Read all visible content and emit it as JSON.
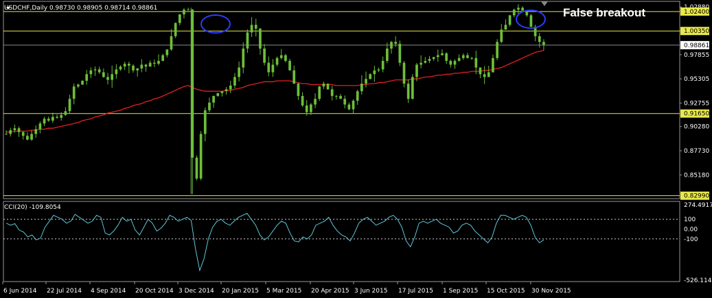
{
  "window": {
    "symbol_line": "USDCHF,Daily  0.98730 0.98905 0.98714 0.98861",
    "indicator_line": "CCI(20) -109.8054",
    "annotation": "False breakout"
  },
  "colors": {
    "background": "#000000",
    "candles": "#6cbf3a",
    "moving_average": "#e52020",
    "level_lines": "#e8e84a",
    "cci_line": "#5fc8d8",
    "grid_text": "#ffffff",
    "highlight_ellipse": "#2a3dff"
  },
  "chart_data": [
    {
      "type": "candlestick",
      "title": "USDCHF,Daily",
      "ohlc_latest": {
        "open": 0.9873,
        "high": 0.98905,
        "low": 0.98714,
        "close": 0.98861
      },
      "ylim": [
        0.8275,
        1.034
      ],
      "y_ticks": [
        "1.02880",
        "1.00350",
        "0.97855",
        "0.95305",
        "0.92755",
        "0.90280",
        "0.87730",
        "0.85180"
      ],
      "level_lines": [
        {
          "value": 1.024,
          "label": "1.02400"
        },
        {
          "value": 1.0035,
          "label": "1.00350"
        },
        {
          "value": 0.9165,
          "label": "0.91650"
        },
        {
          "value": 0.8299,
          "label": "0.82990"
        }
      ],
      "current_price": {
        "value": 0.98861,
        "label": "0.98861"
      },
      "x_labels": [
        "6 Jun 2014",
        "22 Jul 2014",
        "4 Sep 2014",
        "20 Oct 2014",
        "3 Dec 2014",
        "20 Jan 2015",
        "5 Mar 2015",
        "20 Apr 2015",
        "3 Jun 2015",
        "17 Jul 2015",
        "1 Sep 2015",
        "15 Oct 2015",
        "30 Nov 2015"
      ],
      "close_series": [
        0.895,
        0.899,
        0.901,
        0.897,
        0.893,
        0.889,
        0.895,
        0.9,
        0.906,
        0.911,
        0.909,
        0.913,
        0.912,
        0.915,
        0.919,
        0.932,
        0.945,
        0.947,
        0.951,
        0.958,
        0.962,
        0.963,
        0.96,
        0.955,
        0.952,
        0.958,
        0.963,
        0.966,
        0.969,
        0.967,
        0.962,
        0.964,
        0.968,
        0.966,
        0.97,
        0.969,
        0.972,
        0.978,
        0.984,
        0.998,
        1.012,
        1.021,
        1.026,
        1.026,
        0.87,
        0.848,
        0.895,
        0.92,
        0.928,
        0.935,
        0.938,
        0.94,
        0.942,
        0.946,
        0.955,
        0.965,
        0.985,
        1.002,
        1.01,
        1.006,
        0.985,
        0.97,
        0.96,
        0.968,
        0.975,
        0.978,
        0.972,
        0.962,
        0.948,
        0.935,
        0.925,
        0.918,
        0.926,
        0.932,
        0.945,
        0.948,
        0.942,
        0.935,
        0.935,
        0.932,
        0.926,
        0.921,
        0.93,
        0.94,
        0.948,
        0.953,
        0.958,
        0.962,
        0.963,
        0.972,
        0.985,
        0.992,
        0.99,
        0.97,
        0.948,
        0.932,
        0.955,
        0.968,
        0.97,
        0.972,
        0.974,
        0.976,
        0.978,
        0.98,
        0.972,
        0.968,
        0.972,
        0.975,
        0.978,
        0.975,
        0.975,
        0.965,
        0.958,
        0.955,
        0.96,
        0.975,
        0.992,
        1.005,
        1.01,
        1.02,
        1.026,
        1.028,
        1.025,
        1.02,
        1.008,
        0.998,
        0.992,
        0.989
      ],
      "ma_series": [
        0.897,
        0.897,
        0.898,
        0.898,
        0.898,
        0.898,
        0.899,
        0.899,
        0.9,
        0.9,
        0.901,
        0.901,
        0.902,
        0.903,
        0.904,
        0.905,
        0.906,
        0.907,
        0.909,
        0.91,
        0.911,
        0.913,
        0.914,
        0.915,
        0.917,
        0.918,
        0.919,
        0.92,
        0.922,
        0.923,
        0.925,
        0.926,
        0.927,
        0.929,
        0.93,
        0.932,
        0.933,
        0.935,
        0.937,
        0.939,
        0.941,
        0.943,
        0.945,
        0.946,
        0.944,
        0.942,
        0.941,
        0.94,
        0.94,
        0.94,
        0.94,
        0.94,
        0.941,
        0.941,
        0.942,
        0.943,
        0.944,
        0.946,
        0.947,
        0.948,
        0.949,
        0.95,
        0.95,
        0.95,
        0.951,
        0.951,
        0.951,
        0.951,
        0.95,
        0.949,
        0.948,
        0.948,
        0.947,
        0.947,
        0.947,
        0.947,
        0.947,
        0.947,
        0.946,
        0.946,
        0.946,
        0.946,
        0.946,
        0.946,
        0.947,
        0.947,
        0.948,
        0.948,
        0.949,
        0.949,
        0.95,
        0.951,
        0.952,
        0.952,
        0.952,
        0.952,
        0.953,
        0.953,
        0.954,
        0.955,
        0.955,
        0.956,
        0.957,
        0.957,
        0.958,
        0.958,
        0.959,
        0.959,
        0.96,
        0.96,
        0.961,
        0.961,
        0.961,
        0.962,
        0.962,
        0.963,
        0.964,
        0.965,
        0.967,
        0.969,
        0.971,
        0.973,
        0.975,
        0.977,
        0.979,
        0.981,
        0.982,
        0.983
      ],
      "annotation": "False breakout"
    },
    {
      "type": "line",
      "title": "CCI(20) -109.8054",
      "ylim": [
        -526.1143,
        274.4917
      ],
      "y_ticks": [
        "274.4917",
        "100",
        "0.00",
        "-100",
        "-526.1143"
      ],
      "reference_lines": [
        100,
        -100
      ],
      "values": [
        60,
        40,
        55,
        -10,
        -30,
        -80,
        -60,
        -110,
        -90,
        20,
        80,
        140,
        120,
        100,
        60,
        80,
        150,
        120,
        90,
        60,
        80,
        140,
        120,
        -40,
        -60,
        -20,
        40,
        120,
        80,
        100,
        -10,
        -60,
        20,
        100,
        60,
        -20,
        10,
        60,
        140,
        120,
        80,
        100,
        120,
        90,
        -200,
        -420,
        -300,
        -100,
        20,
        80,
        100,
        60,
        40,
        80,
        120,
        140,
        160,
        100,
        40,
        -60,
        -110,
        -80,
        -20,
        40,
        80,
        60,
        -40,
        -120,
        -130,
        -80,
        -100,
        -60,
        40,
        60,
        80,
        120,
        40,
        -20,
        -60,
        -80,
        -120,
        -40,
        60,
        100,
        120,
        80,
        40,
        60,
        80,
        120,
        140,
        100,
        20,
        -120,
        -180,
        -80,
        60,
        80,
        60,
        80,
        100,
        60,
        40,
        20,
        -40,
        -20,
        40,
        60,
        40,
        -20,
        -60,
        -100,
        -140,
        -80,
        60,
        140,
        140,
        120,
        100,
        120,
        140,
        120,
        40,
        -80,
        -140,
        -110
      ],
      "value_label": "-109.8054"
    }
  ]
}
